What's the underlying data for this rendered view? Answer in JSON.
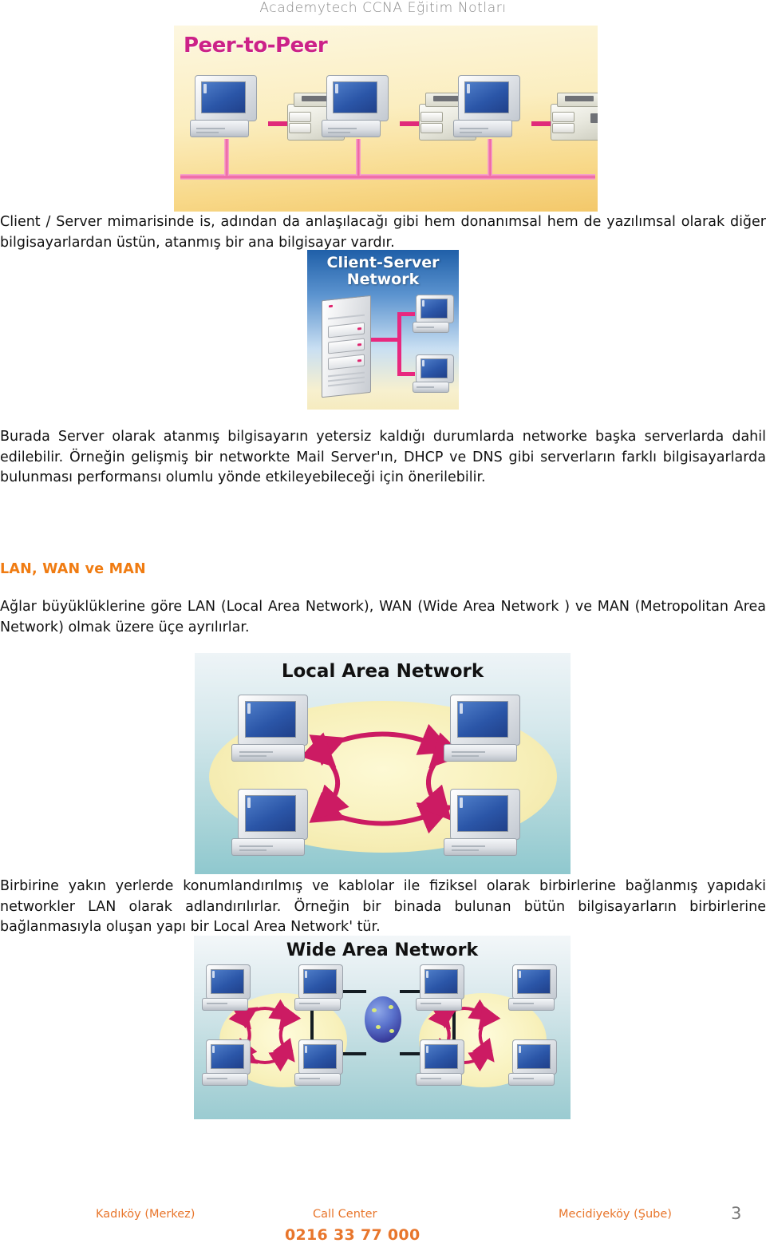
{
  "header": {
    "title": "Academytech CCNA Eğitim Notları",
    "color": "#8a8a8a"
  },
  "figures": {
    "peer_to_peer": {
      "title": "Peer-to-Peer",
      "title_color": "#cc2288",
      "node_count": 3,
      "description": "Three computer and printer pairs connected to a shared pink bus line"
    },
    "client_server": {
      "title_line1": "Client-Server",
      "title_line2": "Network",
      "title_color": "#ffffff",
      "server_count": 1,
      "client_count": 2,
      "link_color": "#e8287f"
    },
    "local_area_network": {
      "title": "Local Area Network",
      "title_color": "#111111",
      "computer_count": 4,
      "arrow_color": "#cc1b63"
    },
    "wide_area_network": {
      "title": "Wide Area Network",
      "title_color": "#111111",
      "cloud_count": 2,
      "computers_per_cloud": 4,
      "arrow_color": "#cc1b63",
      "link_color": "#141c22"
    }
  },
  "body": {
    "paragraph_1": "Client / Server mimarisinde is, adından da anlaşılacağı gibi hem donanımsal hem de yazılımsal olarak diğer bilgisayarlardan üstün, atanmış bir ana bilgisayar vardır.",
    "paragraph_2": "Burada Server olarak atanmış bilgisayarın yetersiz kaldığı durumlarda networke başka serverlarda dahil edilebilir. Örneğin gelişmiş bir networkte Mail Server'ın, DHCP ve DNS gibi serverların farklı bilgisayarlarda bulunması performansı olumlu yönde etkileyebileceği için önerilebilir.",
    "heading_lan_wan_man": "LAN, WAN ve MAN",
    "heading_color": "#F07C12",
    "paragraph_3": "Ağlar büyüklüklerine göre LAN (Local Area Network), WAN (Wide Area Network ) ve MAN (Metropolitan Area Network) olmak üzere üçe ayrılırlar.",
    "paragraph_4": "Birbirine yakın yerlerde konumlandırılmış ve kablolar ile fiziksel olarak birbirlerine bağlanmış yapıdaki networkler LAN olarak adlandırılırlar. Örneğin bir binada bulunan bütün bilgisayarların birbirlerine bağlanmasıyla oluşan yapı bir Local Area Network' tür."
  },
  "footer": {
    "branch_left": "Kadıköy (Merkez)",
    "call_center_label": "Call Center",
    "branch_right": "Mecidiyeköy (Şube)",
    "phone": "0216 33 77 000",
    "page_number": "3",
    "text_color": "#E8762C",
    "page_number_color": "#7a7a7a"
  }
}
